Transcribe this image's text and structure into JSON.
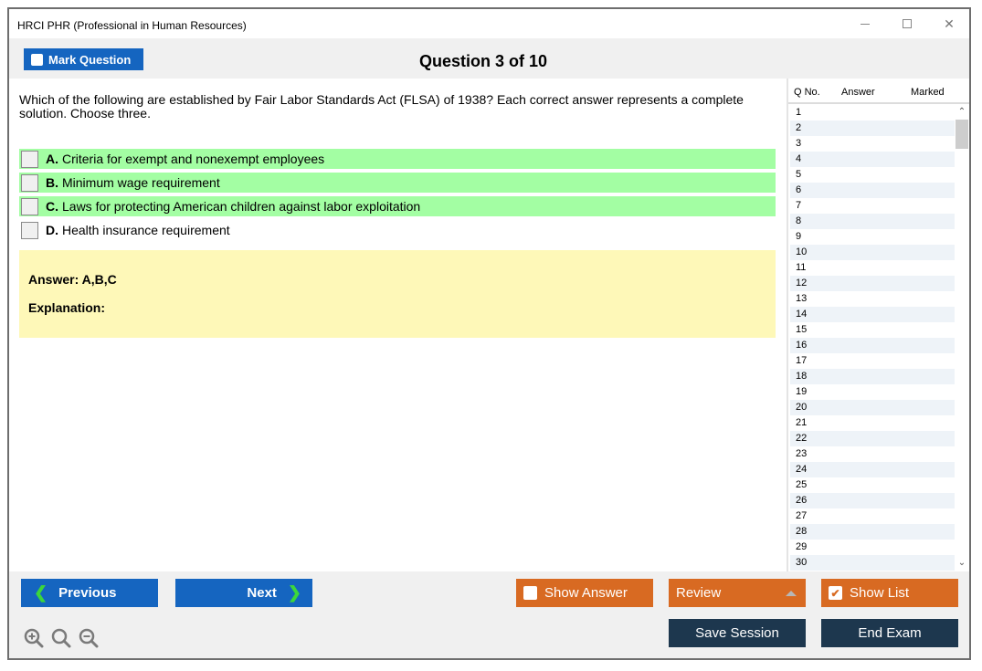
{
  "window": {
    "title": "HRCI PHR (Professional in Human Resources)",
    "controls": [
      "minimize",
      "maximize",
      "close"
    ]
  },
  "toolbar": {
    "mark_question_label": "Mark Question",
    "question_counter": "Question 3 of 10"
  },
  "question": {
    "text": "Which of the following are established by Fair Labor Standards Act (FLSA) of 1938? Each correct answer represents a complete solution. Choose three.",
    "options": [
      {
        "letter": "A.",
        "text": "Criteria for exempt and nonexempt employees",
        "correct": true,
        "checked": false
      },
      {
        "letter": "B.",
        "text": "Minimum wage requirement",
        "correct": true,
        "checked": false
      },
      {
        "letter": "C.",
        "text": "Laws for protecting American children against labor exploitation",
        "correct": true,
        "checked": false
      },
      {
        "letter": "D.",
        "text": "Health insurance requirement",
        "correct": false,
        "checked": false
      }
    ],
    "answer_label": "Answer: A,B,C",
    "explanation_label": "Explanation:"
  },
  "question_list": {
    "headers": {
      "no": "Q No.",
      "answer": "Answer",
      "marked": "Marked"
    },
    "rows": [
      "1",
      "2",
      "3",
      "4",
      "5",
      "6",
      "7",
      "8",
      "9",
      "10",
      "11",
      "12",
      "13",
      "14",
      "15",
      "16",
      "17",
      "18",
      "19",
      "20",
      "21",
      "22",
      "23",
      "24",
      "25",
      "26",
      "27",
      "28",
      "29",
      "30"
    ]
  },
  "buttons": {
    "previous": "Previous",
    "next": "Next",
    "show_answer": "Show Answer",
    "show_answer_checked": false,
    "review": "Review",
    "show_list": "Show List",
    "show_list_checked": true,
    "save_session": "Save Session",
    "end_exam": "End Exam"
  },
  "zoom_controls": [
    "zoom-in",
    "zoom-reset",
    "zoom-out"
  ],
  "colors": {
    "primary_blue": "#1565c0",
    "orange": "#d86a22",
    "dark_navy": "#1d374e",
    "correct_green": "#a3fea3",
    "answer_yellow": "#fef8b8"
  }
}
